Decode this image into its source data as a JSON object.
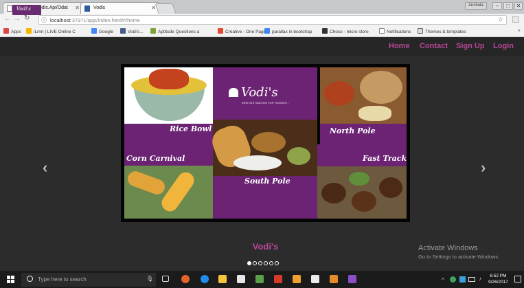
{
  "browser": {
    "tabs": [
      {
        "label": "localhost/Vodis.Api/Odat"
      },
      {
        "label": "Vodis"
      }
    ],
    "user_badge": "Anshula",
    "window_controls": [
      "–",
      "□",
      "✕"
    ],
    "address": {
      "host": "localhost",
      "rest": ":37971/app/Index.html#!/home"
    },
    "bookmarks": [
      {
        "label": "Apps",
        "color": "#d44"
      },
      {
        "label": "iLrnn | LIVE Online C",
        "color": "#f4b400"
      },
      {
        "label": "Google",
        "color": "#4285f4"
      },
      {
        "label": "Vodi's...",
        "color": "#4a5c8c"
      },
      {
        "label": "Aptitude Questions a",
        "color": "#7aa33a"
      },
      {
        "label": "Creative - One Page",
        "color": "#e24a2e"
      },
      {
        "label": "parallax in bootstrap",
        "color": "#4285f4"
      },
      {
        "label": "Choco - micro store",
        "color": "#333"
      },
      {
        "label": "Notifications",
        "color": "#bbb"
      },
      {
        "label": "Themes & templates",
        "color": "#666"
      }
    ]
  },
  "site": {
    "brand": "Vodi's",
    "nav": [
      "Home",
      "Contact",
      "Sign Up",
      "Login"
    ],
    "carousel": {
      "logo_title": "Vodi's",
      "logo_tagline": "NEW DESTINATION FOR FOODIES...",
      "labels": {
        "rice_bowl": "Rice Bowl",
        "north_pole": "North Pole",
        "corn_carnival": "Corn Carnival",
        "fast_track": "Fast Track",
        "south_pole": "South Pole"
      },
      "caption": "Vodi's",
      "slides_total": 6,
      "active_slide": 1,
      "prev": "‹",
      "next": "›"
    }
  },
  "watermark": {
    "line1": "Activate Windows",
    "line2": "Go to Settings to activate Windows."
  },
  "taskbar": {
    "search_placeholder": "Type here to search",
    "time": "6:52 PM",
    "date": "9/26/2017"
  }
}
